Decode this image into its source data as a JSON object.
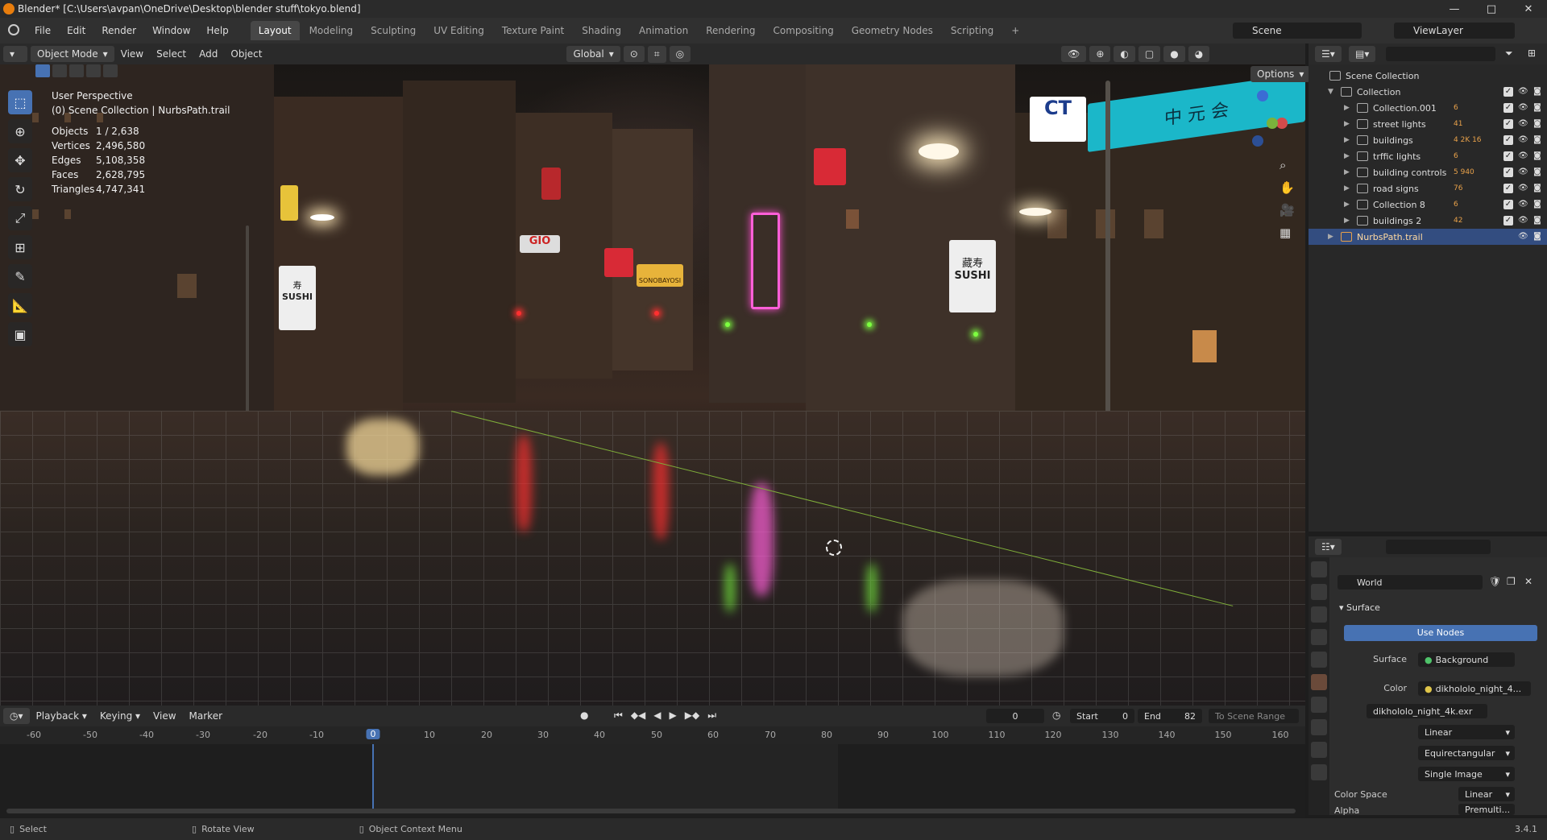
{
  "window": {
    "title": "Blender* [C:\\Users\\avpan\\OneDrive\\Desktop\\blender stuff\\tokyo.blend]",
    "buttons": [
      "—",
      "□",
      "✕"
    ]
  },
  "menu": [
    "File",
    "Edit",
    "Render",
    "Window",
    "Help"
  ],
  "workspaces": [
    "Layout",
    "Modeling",
    "Sculpting",
    "UV Editing",
    "Texture Paint",
    "Shading",
    "Animation",
    "Rendering",
    "Compositing",
    "Geometry Nodes",
    "Scripting"
  ],
  "active_workspace": "Layout",
  "add_workspace": "+",
  "scene": "Scene",
  "view_layer": "ViewLayer",
  "viewport_header": {
    "mode": "Object Mode",
    "menus": [
      "View",
      "Select",
      "Add",
      "Object"
    ],
    "transform": "Global",
    "options": "Options"
  },
  "viewport_info": {
    "perspective": "User Perspective",
    "context": "(0) Scene Collection | NurbsPath.trail",
    "stats": [
      {
        "label": "Objects",
        "value": "1 / 2,638"
      },
      {
        "label": "Vertices",
        "value": "2,496,580"
      },
      {
        "label": "Edges",
        "value": "5,108,358"
      },
      {
        "label": "Faces",
        "value": "2,628,795"
      },
      {
        "label": "Triangles",
        "value": "4,747,341"
      }
    ]
  },
  "scene_text": {
    "sign_sushi_left": [
      "寿",
      "SUSHI"
    ],
    "sign_sushi_right": [
      "藏寿",
      "SUSHI"
    ],
    "sign_blue": "中 元 会",
    "sign_ct": "CT",
    "sign_gio": "GIO",
    "sign_sonoayosi": "SONOBAYOSI"
  },
  "outliner": {
    "root": "Scene Collection",
    "collection": "Collection",
    "items": [
      {
        "name": "Collection.001",
        "badge": "6"
      },
      {
        "name": "street lights",
        "badge": "41"
      },
      {
        "name": "buildings",
        "badge": "4 2K 16"
      },
      {
        "name": "trffic lights",
        "badge": "6"
      },
      {
        "name": "building controls",
        "badge": "5 940"
      },
      {
        "name": "road signs",
        "badge": "76"
      },
      {
        "name": "Collection 8",
        "badge": "6"
      },
      {
        "name": "buildings 2",
        "badge": "42"
      },
      {
        "name": "NurbsPath.trail",
        "badge": ""
      }
    ],
    "selected": "NurbsPath.trail"
  },
  "properties": {
    "world": "World",
    "panel_surface": "Surface",
    "use_nodes": "Use Nodes",
    "surface_label": "Surface",
    "surface_value": "Background",
    "color_label": "Color",
    "color_value": "dikhololo_night_4...",
    "image_name": "dikhololo_night_4k.exr",
    "interp": "Linear",
    "projection": "Equirectangular",
    "source": "Single Image",
    "color_space_label": "Color Space",
    "color_space_value": "Linear",
    "alpha_label": "Alpha",
    "alpha_value": "Premulti..."
  },
  "timeline": {
    "menus": [
      "Playback",
      "Keying",
      "View",
      "Marker"
    ],
    "current_frame": "0",
    "start_label": "Start",
    "start": "0",
    "end_label": "End",
    "end": "82",
    "scene_range": "To Scene Range",
    "ticks": [
      "-60",
      "-50",
      "-40",
      "-30",
      "-20",
      "-10",
      "0",
      "10",
      "20",
      "30",
      "40",
      "50",
      "60",
      "70",
      "80",
      "90",
      "100",
      "110",
      "120",
      "130",
      "140",
      "150",
      "160"
    ],
    "playhead_label": "0"
  },
  "status": {
    "select": "Select",
    "rotate": "Rotate View",
    "context_menu": "Object Context Menu",
    "version": "3.4.1"
  },
  "colors": {
    "accent": "#4772b3",
    "header": "#303030",
    "panel": "#282828",
    "selected_row": "#334d80",
    "blender_orange": "#e87d0d"
  }
}
